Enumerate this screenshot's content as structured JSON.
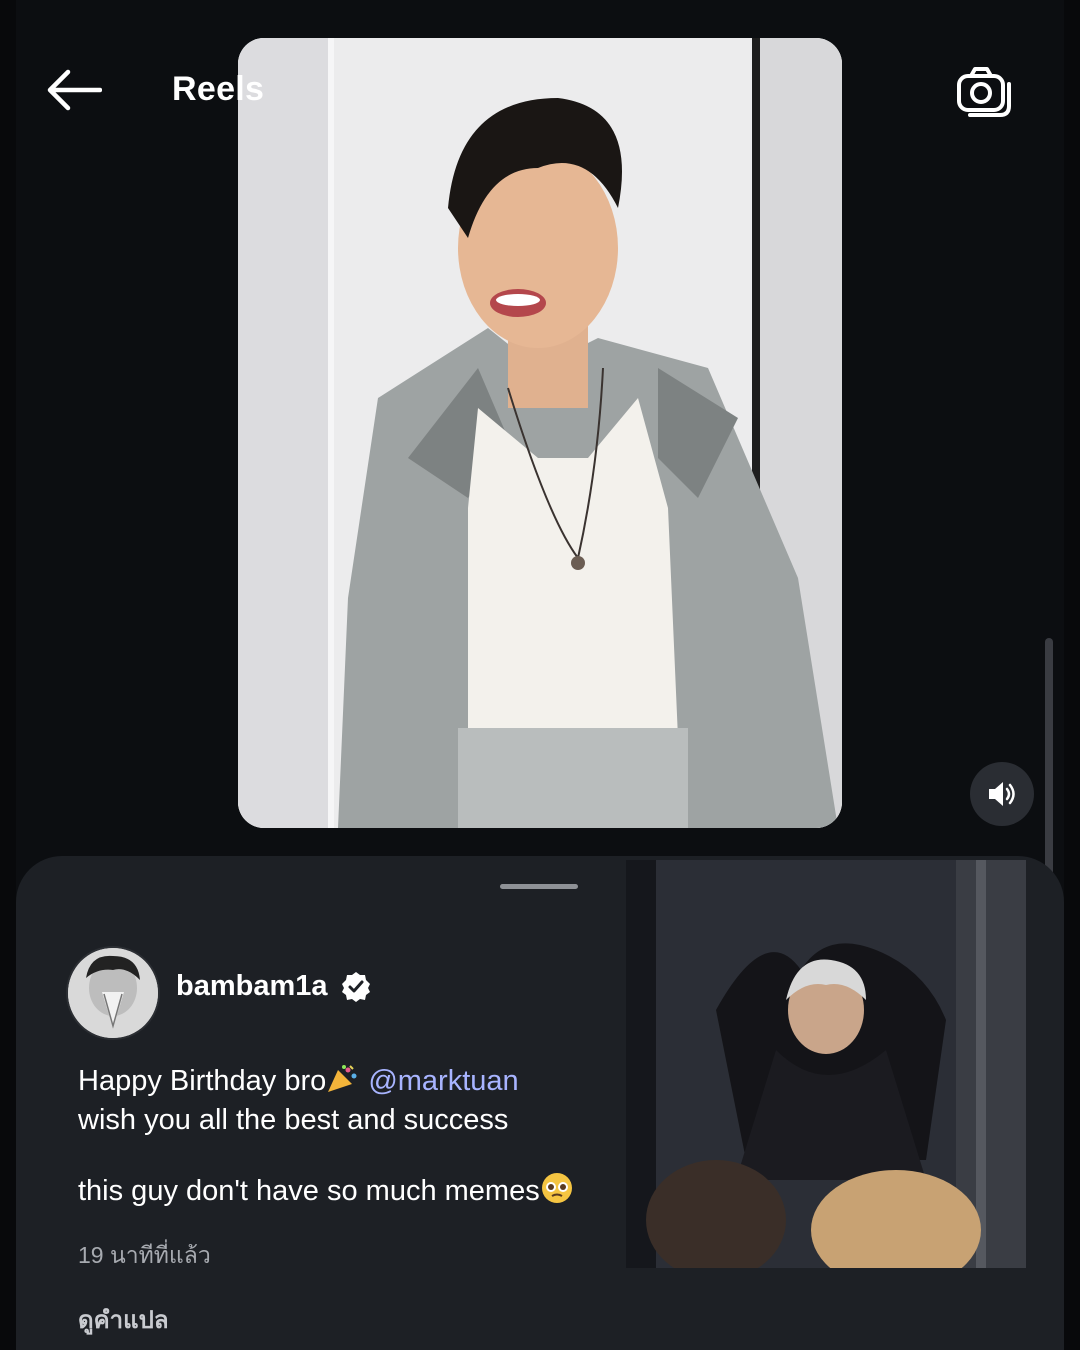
{
  "topbar": {
    "title": "Reels",
    "back_icon": "arrow-left-icon",
    "camera_icon": "camera-icon"
  },
  "reel": {
    "photo": "person-in-silver-suit-photo",
    "mute_icon": "volume-icon"
  },
  "post": {
    "username": "bambam1a",
    "verified_icon": "verified-badge-icon",
    "caption_line1": "Happy Birthday bro",
    "mention": "@marktuan",
    "caption_line2": "wish you all the best and success",
    "caption_line3": "this guy don't have so much memes",
    "emoji_party": "party-popper-icon",
    "emoji_pleading": "pleading-face-icon",
    "timestamp": "19 นาทีที่แล้ว",
    "translate": "ดูคำแปล"
  },
  "thumbnail": {
    "image": "heart-gesture-video-thumbnail"
  },
  "colors": {
    "background": "#0c0e11",
    "sheet": "#1d2025",
    "mention": "#a8b4ff",
    "muted_text": "#a7aab0"
  }
}
